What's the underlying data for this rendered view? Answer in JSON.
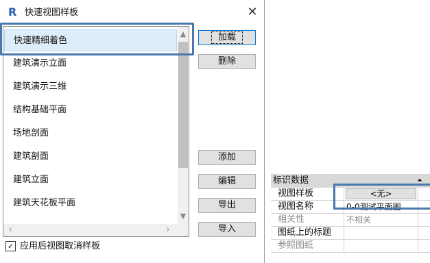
{
  "dialog": {
    "title": "快速视图样板",
    "app_icon": "R",
    "close_glyph": "✕",
    "templates": [
      "快速精细着色",
      "建筑演示立面",
      "建筑演示三维",
      "结构基础平面",
      "场地剖面",
      "建筑剖面",
      "建筑立面",
      "建筑天花板平面",
      ""
    ],
    "selected_index": 0,
    "buttons": {
      "load": "加载",
      "delete": "删除",
      "add": "添加",
      "edit": "编辑",
      "export": "导出",
      "import": "导入"
    },
    "checkbox": {
      "label": "应用后视图取消样板",
      "checked": true,
      "mark": "✓"
    }
  },
  "properties": {
    "section_title": "标识数据",
    "collapse_glyph": "⏶",
    "rows": [
      {
        "name": "视图样板",
        "value": "<无>",
        "type": "button"
      },
      {
        "name": "视图名称",
        "value": "0-0测试平面图...",
        "type": "text"
      },
      {
        "name": "相关性",
        "value": "不相关",
        "type": "text",
        "disabled": true
      },
      {
        "name": "图纸上的标题",
        "value": "",
        "type": "text"
      },
      {
        "name": "参照图纸",
        "value": "",
        "type": "text",
        "disabled": true
      }
    ]
  },
  "colors": {
    "highlight": "#4a77ad",
    "selection": "#ddeefa",
    "button_face": "#e1e1e1",
    "focus_border": "#0078d7"
  }
}
